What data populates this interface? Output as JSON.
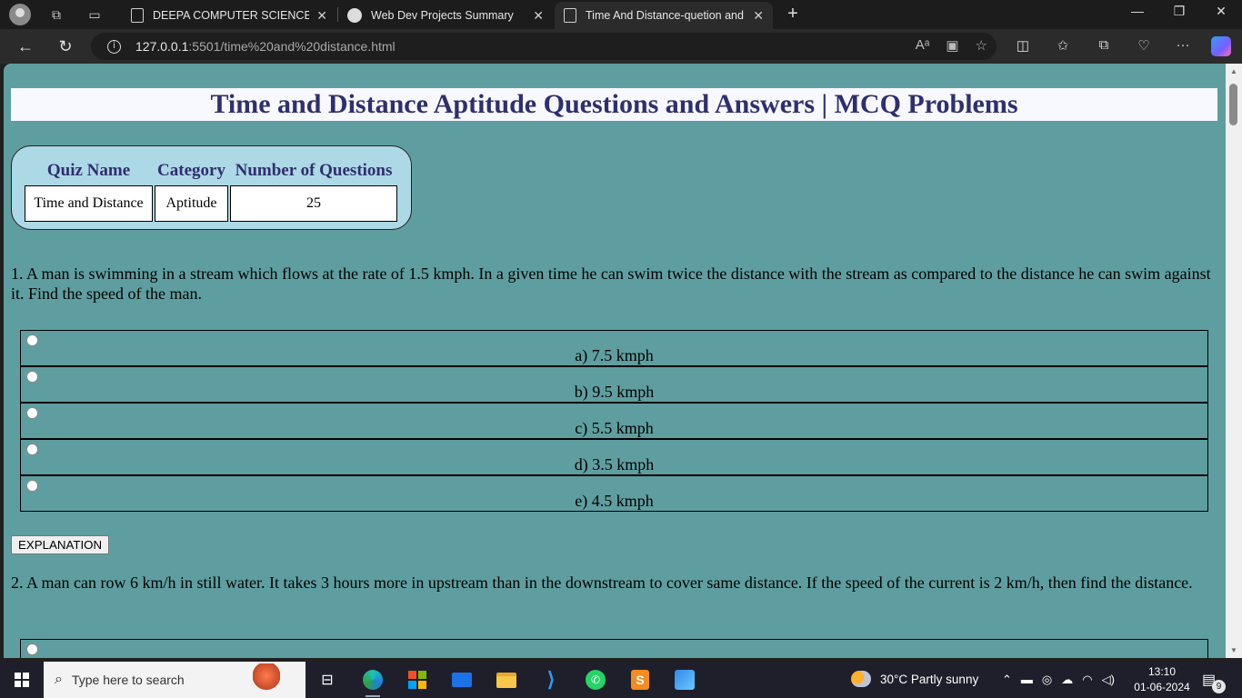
{
  "browser": {
    "tabs": [
      {
        "label": "DEEPA COMPUTER SCIENCE STU",
        "active": false
      },
      {
        "label": "Web Dev Projects Summary",
        "active": false
      },
      {
        "label": "Time And Distance-quetion and",
        "active": true
      }
    ],
    "url_host": "127.0.0.1",
    "url_rest": ":5501/time%20and%20distance.html"
  },
  "page": {
    "title": "Time and Distance Aptitude Questions and Answers | MCQ Problems",
    "quiz_table": {
      "headers": [
        "Quiz Name",
        "Category",
        "Number of Questions"
      ],
      "row": [
        "Time and Distance",
        "Aptitude",
        "25"
      ]
    },
    "questions": [
      {
        "text": "1. A man is swimming in a stream which flows at the rate of 1.5 kmph. In a given time he can swim twice the distance with the stream as compared to the distance he can swim against it. Find the speed of the man.",
        "options": [
          "a) 7.5 kmph",
          "b) 9.5 kmph",
          "c) 5.5 kmph",
          "d) 3.5 kmph",
          "e) 4.5 kmph"
        ]
      },
      {
        "text": "2. A man can row 6 km/h in still water. It takes 3 hours more in upstream than in the downstream to cover same distance. If the speed of the current is 2 km/h, then find the distance."
      }
    ],
    "explanation_button": "EXPLANATION"
  },
  "taskbar": {
    "search_placeholder": "Type here to search",
    "weather": "30°C  Partly sunny",
    "time": "13:10",
    "date": "01-06-2024",
    "notification_count": "9"
  },
  "colors": {
    "page_bg": "#5f9ea0",
    "title_color": "#2f2f6f",
    "quiz_box_bg": "#add8e6"
  }
}
